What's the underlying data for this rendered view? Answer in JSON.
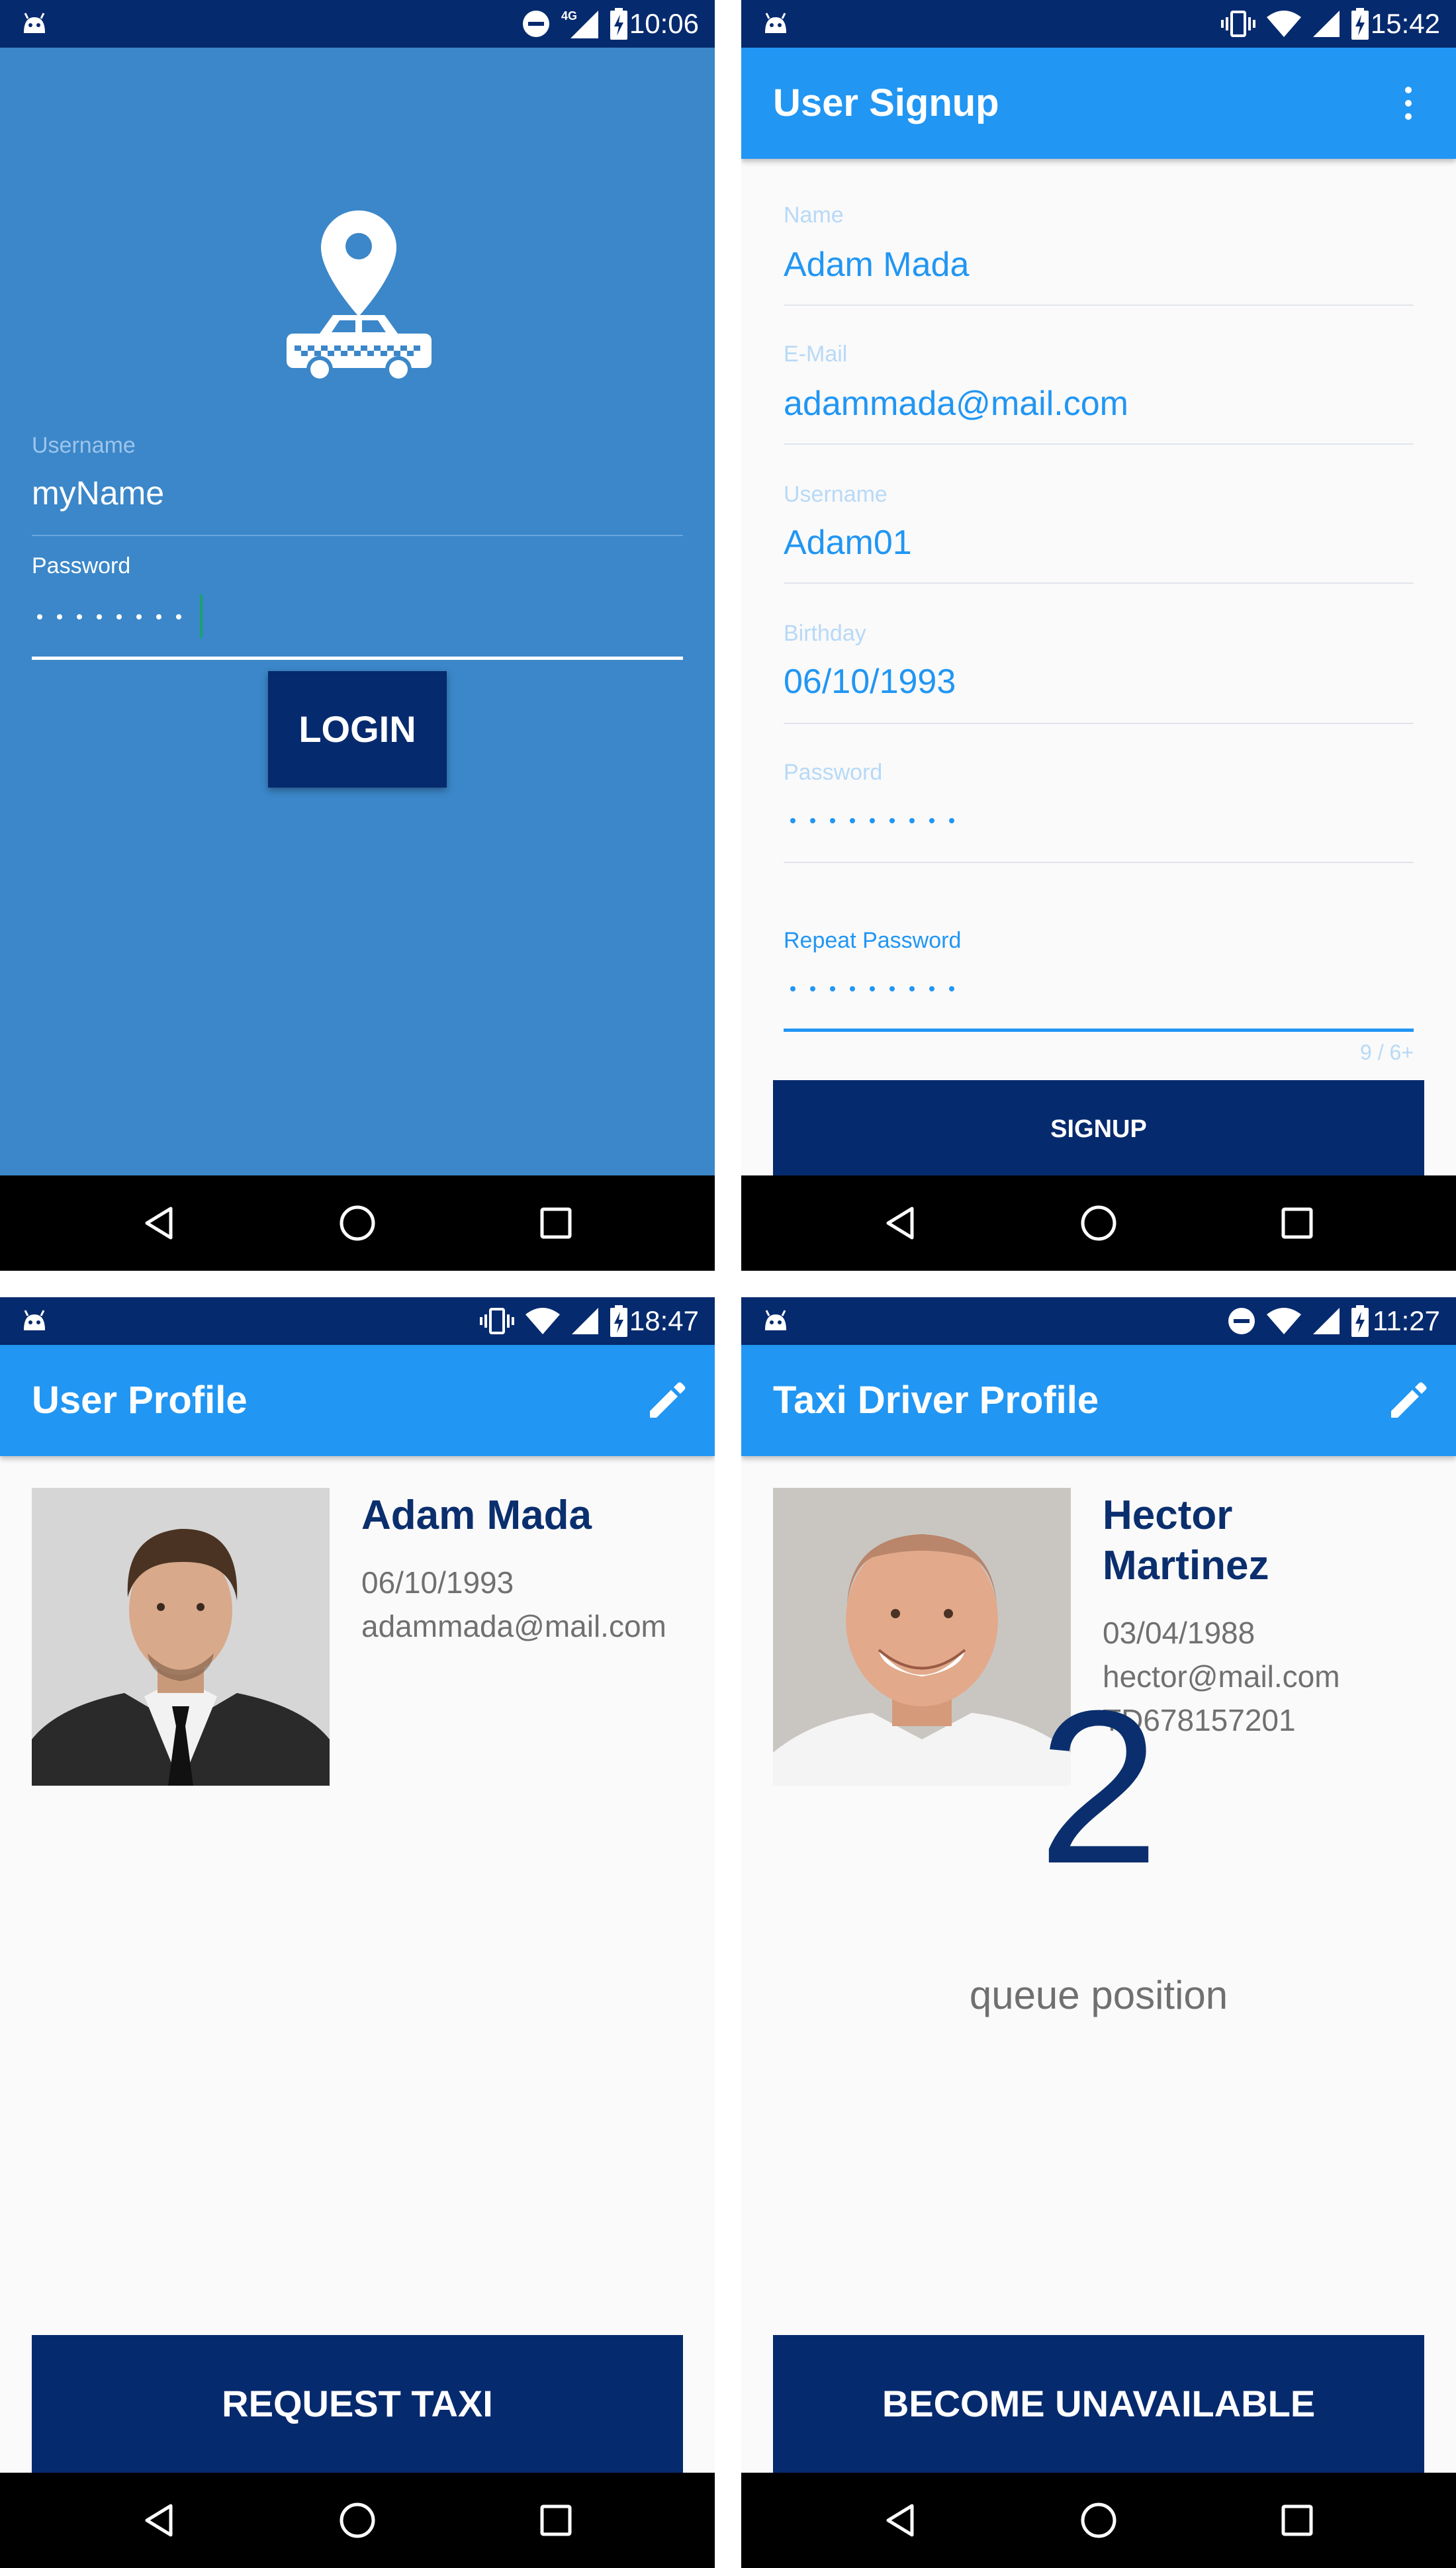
{
  "screens": {
    "login": {
      "time": "10:06",
      "network": "4G",
      "username_label": "Username",
      "username_value": "myName",
      "password_label": "Password",
      "password_length": 8,
      "login_button": "LOGIN"
    },
    "signup": {
      "time": "15:42",
      "title": "User Signup",
      "fields": [
        {
          "label": "Name",
          "value": "Adam Mada"
        },
        {
          "label": "E-Mail",
          "value": "adammada@mail.com"
        },
        {
          "label": "Username",
          "value": "Adam01"
        },
        {
          "label": "Birthday",
          "value": "06/10/1993"
        },
        {
          "label": "Password",
          "value_dots": 9
        },
        {
          "label": "Repeat Password",
          "value_dots": 9
        }
      ],
      "counter": "9 / 6+",
      "signup_button": "SIGNUP"
    },
    "user_profile": {
      "time": "18:47",
      "title": "User Profile",
      "name": "Adam Mada",
      "birthday": "06/10/1993",
      "email": "adammada@mail.com",
      "request_button": "REQUEST TAXI"
    },
    "driver_profile": {
      "time": "11:27",
      "title": "Taxi Driver Profile",
      "name_line1": "Hector",
      "name_line2": "Martinez",
      "birthday": "03/04/1988",
      "email": "hector@mail.com",
      "license": "TD678157201",
      "queue_number": "2",
      "queue_label": "queue position",
      "unavailable_button": "BECOME UNAVAILABLE"
    }
  },
  "icons": {
    "status": [
      "android-icon",
      "dnd-icon",
      "vibrate-icon",
      "wifi-icon",
      "signal-icon",
      "battery-charging-icon"
    ],
    "nav": [
      "back-icon",
      "home-icon",
      "recents-icon"
    ],
    "appbar": [
      "more-vert-icon",
      "edit-pencil-icon"
    ]
  },
  "colors": {
    "status_bar": "#062a6e",
    "login_background": "#3b87c9",
    "app_bar": "#2196f3",
    "primary_dark_button": "#062a6e",
    "accent_text": "#2196f3",
    "nav_bar": "#000000"
  }
}
